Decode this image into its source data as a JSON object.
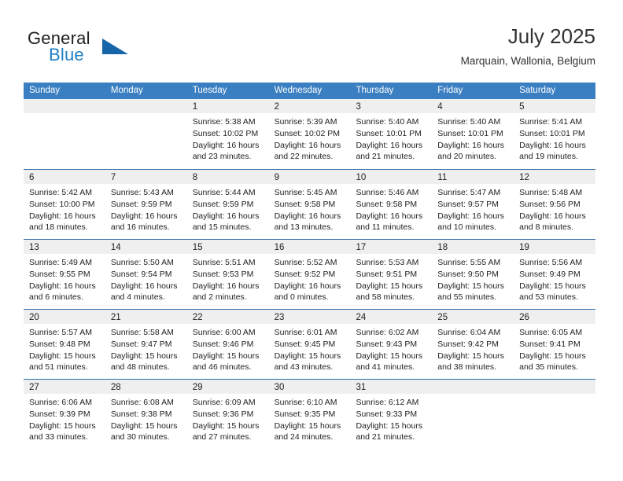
{
  "brand": {
    "name_part1": "General",
    "name_part2": "Blue",
    "triangle_icon": "triangle-icon",
    "accent_color": "#1f7fc4"
  },
  "header": {
    "title": "July 2025",
    "location": "Marquain, Wallonia, Belgium"
  },
  "theme": {
    "header_blue": "#3a7fc1",
    "row_separator_blue": "#2a6ca8",
    "day_band_gray": "#efefef"
  },
  "weekdays": [
    "Sunday",
    "Monday",
    "Tuesday",
    "Wednesday",
    "Thursday",
    "Friday",
    "Saturday"
  ],
  "weeks": [
    [
      {
        "day": "",
        "lines": []
      },
      {
        "day": "",
        "lines": []
      },
      {
        "day": "1",
        "lines": [
          "Sunrise: 5:38 AM",
          "Sunset: 10:02 PM",
          "Daylight: 16 hours",
          "and 23 minutes."
        ]
      },
      {
        "day": "2",
        "lines": [
          "Sunrise: 5:39 AM",
          "Sunset: 10:02 PM",
          "Daylight: 16 hours",
          "and 22 minutes."
        ]
      },
      {
        "day": "3",
        "lines": [
          "Sunrise: 5:40 AM",
          "Sunset: 10:01 PM",
          "Daylight: 16 hours",
          "and 21 minutes."
        ]
      },
      {
        "day": "4",
        "lines": [
          "Sunrise: 5:40 AM",
          "Sunset: 10:01 PM",
          "Daylight: 16 hours",
          "and 20 minutes."
        ]
      },
      {
        "day": "5",
        "lines": [
          "Sunrise: 5:41 AM",
          "Sunset: 10:01 PM",
          "Daylight: 16 hours",
          "and 19 minutes."
        ]
      }
    ],
    [
      {
        "day": "6",
        "lines": [
          "Sunrise: 5:42 AM",
          "Sunset: 10:00 PM",
          "Daylight: 16 hours",
          "and 18 minutes."
        ]
      },
      {
        "day": "7",
        "lines": [
          "Sunrise: 5:43 AM",
          "Sunset: 9:59 PM",
          "Daylight: 16 hours",
          "and 16 minutes."
        ]
      },
      {
        "day": "8",
        "lines": [
          "Sunrise: 5:44 AM",
          "Sunset: 9:59 PM",
          "Daylight: 16 hours",
          "and 15 minutes."
        ]
      },
      {
        "day": "9",
        "lines": [
          "Sunrise: 5:45 AM",
          "Sunset: 9:58 PM",
          "Daylight: 16 hours",
          "and 13 minutes."
        ]
      },
      {
        "day": "10",
        "lines": [
          "Sunrise: 5:46 AM",
          "Sunset: 9:58 PM",
          "Daylight: 16 hours",
          "and 11 minutes."
        ]
      },
      {
        "day": "11",
        "lines": [
          "Sunrise: 5:47 AM",
          "Sunset: 9:57 PM",
          "Daylight: 16 hours",
          "and 10 minutes."
        ]
      },
      {
        "day": "12",
        "lines": [
          "Sunrise: 5:48 AM",
          "Sunset: 9:56 PM",
          "Daylight: 16 hours",
          "and 8 minutes."
        ]
      }
    ],
    [
      {
        "day": "13",
        "lines": [
          "Sunrise: 5:49 AM",
          "Sunset: 9:55 PM",
          "Daylight: 16 hours",
          "and 6 minutes."
        ]
      },
      {
        "day": "14",
        "lines": [
          "Sunrise: 5:50 AM",
          "Sunset: 9:54 PM",
          "Daylight: 16 hours",
          "and 4 minutes."
        ]
      },
      {
        "day": "15",
        "lines": [
          "Sunrise: 5:51 AM",
          "Sunset: 9:53 PM",
          "Daylight: 16 hours",
          "and 2 minutes."
        ]
      },
      {
        "day": "16",
        "lines": [
          "Sunrise: 5:52 AM",
          "Sunset: 9:52 PM",
          "Daylight: 16 hours",
          "and 0 minutes."
        ]
      },
      {
        "day": "17",
        "lines": [
          "Sunrise: 5:53 AM",
          "Sunset: 9:51 PM",
          "Daylight: 15 hours",
          "and 58 minutes."
        ]
      },
      {
        "day": "18",
        "lines": [
          "Sunrise: 5:55 AM",
          "Sunset: 9:50 PM",
          "Daylight: 15 hours",
          "and 55 minutes."
        ]
      },
      {
        "day": "19",
        "lines": [
          "Sunrise: 5:56 AM",
          "Sunset: 9:49 PM",
          "Daylight: 15 hours",
          "and 53 minutes."
        ]
      }
    ],
    [
      {
        "day": "20",
        "lines": [
          "Sunrise: 5:57 AM",
          "Sunset: 9:48 PM",
          "Daylight: 15 hours",
          "and 51 minutes."
        ]
      },
      {
        "day": "21",
        "lines": [
          "Sunrise: 5:58 AM",
          "Sunset: 9:47 PM",
          "Daylight: 15 hours",
          "and 48 minutes."
        ]
      },
      {
        "day": "22",
        "lines": [
          "Sunrise: 6:00 AM",
          "Sunset: 9:46 PM",
          "Daylight: 15 hours",
          "and 46 minutes."
        ]
      },
      {
        "day": "23",
        "lines": [
          "Sunrise: 6:01 AM",
          "Sunset: 9:45 PM",
          "Daylight: 15 hours",
          "and 43 minutes."
        ]
      },
      {
        "day": "24",
        "lines": [
          "Sunrise: 6:02 AM",
          "Sunset: 9:43 PM",
          "Daylight: 15 hours",
          "and 41 minutes."
        ]
      },
      {
        "day": "25",
        "lines": [
          "Sunrise: 6:04 AM",
          "Sunset: 9:42 PM",
          "Daylight: 15 hours",
          "and 38 minutes."
        ]
      },
      {
        "day": "26",
        "lines": [
          "Sunrise: 6:05 AM",
          "Sunset: 9:41 PM",
          "Daylight: 15 hours",
          "and 35 minutes."
        ]
      }
    ],
    [
      {
        "day": "27",
        "lines": [
          "Sunrise: 6:06 AM",
          "Sunset: 9:39 PM",
          "Daylight: 15 hours",
          "and 33 minutes."
        ]
      },
      {
        "day": "28",
        "lines": [
          "Sunrise: 6:08 AM",
          "Sunset: 9:38 PM",
          "Daylight: 15 hours",
          "and 30 minutes."
        ]
      },
      {
        "day": "29",
        "lines": [
          "Sunrise: 6:09 AM",
          "Sunset: 9:36 PM",
          "Daylight: 15 hours",
          "and 27 minutes."
        ]
      },
      {
        "day": "30",
        "lines": [
          "Sunrise: 6:10 AM",
          "Sunset: 9:35 PM",
          "Daylight: 15 hours",
          "and 24 minutes."
        ]
      },
      {
        "day": "31",
        "lines": [
          "Sunrise: 6:12 AM",
          "Sunset: 9:33 PM",
          "Daylight: 15 hours",
          "and 21 minutes."
        ]
      },
      {
        "day": "",
        "lines": []
      },
      {
        "day": "",
        "lines": []
      }
    ]
  ]
}
